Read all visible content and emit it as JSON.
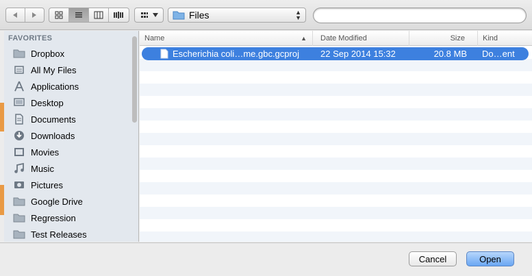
{
  "toolbar": {
    "path_label": "Files",
    "search_placeholder": ""
  },
  "sidebar": {
    "header": "FAVORITES",
    "items": [
      {
        "label": "Dropbox",
        "icon": "folder-icon"
      },
      {
        "label": "All My Files",
        "icon": "all-files-icon"
      },
      {
        "label": "Applications",
        "icon": "applications-icon"
      },
      {
        "label": "Desktop",
        "icon": "desktop-icon"
      },
      {
        "label": "Documents",
        "icon": "documents-icon"
      },
      {
        "label": "Downloads",
        "icon": "downloads-icon"
      },
      {
        "label": "Movies",
        "icon": "movies-icon"
      },
      {
        "label": "Music",
        "icon": "music-icon"
      },
      {
        "label": "Pictures",
        "icon": "pictures-icon"
      },
      {
        "label": "Google Drive",
        "icon": "folder-icon"
      },
      {
        "label": "Regression",
        "icon": "folder-icon"
      },
      {
        "label": "Test Releases",
        "icon": "folder-icon"
      }
    ]
  },
  "columns": {
    "name": "Name",
    "date": "Date Modified",
    "size": "Size",
    "kind": "Kind"
  },
  "files": [
    {
      "name": "Escherichia coli…me.gbc.gcproj",
      "date": "22 Sep 2014 15:32",
      "size": "20.8 MB",
      "kind": "Do…ent",
      "selected": true
    }
  ],
  "buttons": {
    "cancel": "Cancel",
    "open": "Open"
  },
  "colors": {
    "selection": "#3d80df",
    "sidebar_bg": "#e3e8ee",
    "stripe": "#f1f5fa"
  }
}
